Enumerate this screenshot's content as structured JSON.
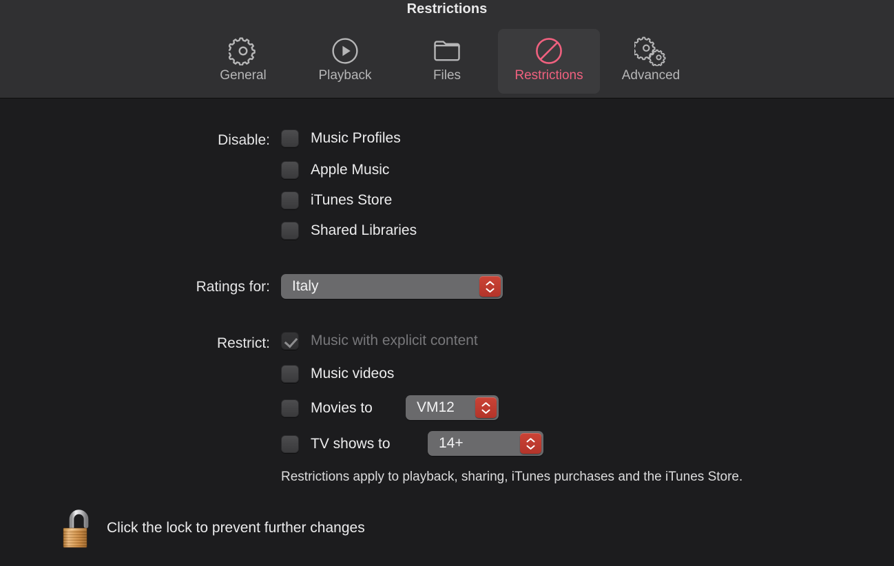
{
  "window": {
    "title": "Restrictions",
    "accent_pink": "#f0617f",
    "stepper_red": "#c0392b",
    "header_bg": "#303032",
    "content_bg": "#1c1c1e"
  },
  "toolbar": {
    "tabs": [
      {
        "label": "General",
        "icon": "gear-icon",
        "selected": false
      },
      {
        "label": "Playback",
        "icon": "play-circle-icon",
        "selected": false
      },
      {
        "label": "Files",
        "icon": "folder-icon",
        "selected": false
      },
      {
        "label": "Restrictions",
        "icon": "no-entry-icon",
        "selected": true
      },
      {
        "label": "Advanced",
        "icon": "double-gear-icon",
        "selected": false
      }
    ]
  },
  "disable_section": {
    "label": "Disable:",
    "items": [
      {
        "label": "Music Profiles",
        "checked": false
      },
      {
        "label": "Apple Music",
        "checked": false
      },
      {
        "label": "iTunes Store",
        "checked": false
      },
      {
        "label": "Shared Libraries",
        "checked": false
      }
    ]
  },
  "ratings_section": {
    "label": "Ratings for:",
    "value": "Italy"
  },
  "restrict_section": {
    "label": "Restrict:",
    "items": [
      {
        "label": "Music with explicit content",
        "checked": true,
        "disabled": true
      },
      {
        "label": "Music videos",
        "checked": false,
        "disabled": false
      },
      {
        "label": "Movies to",
        "checked": false,
        "disabled": false,
        "value": "VM12"
      },
      {
        "label": "TV shows to",
        "checked": false,
        "disabled": false,
        "value": "14+"
      }
    ],
    "footnote": "Restrictions apply to playback, sharing, iTunes purchases and the iTunes Store."
  },
  "lock": {
    "icon": "unlocked-padlock-icon",
    "label": "Click the lock to prevent further changes"
  }
}
